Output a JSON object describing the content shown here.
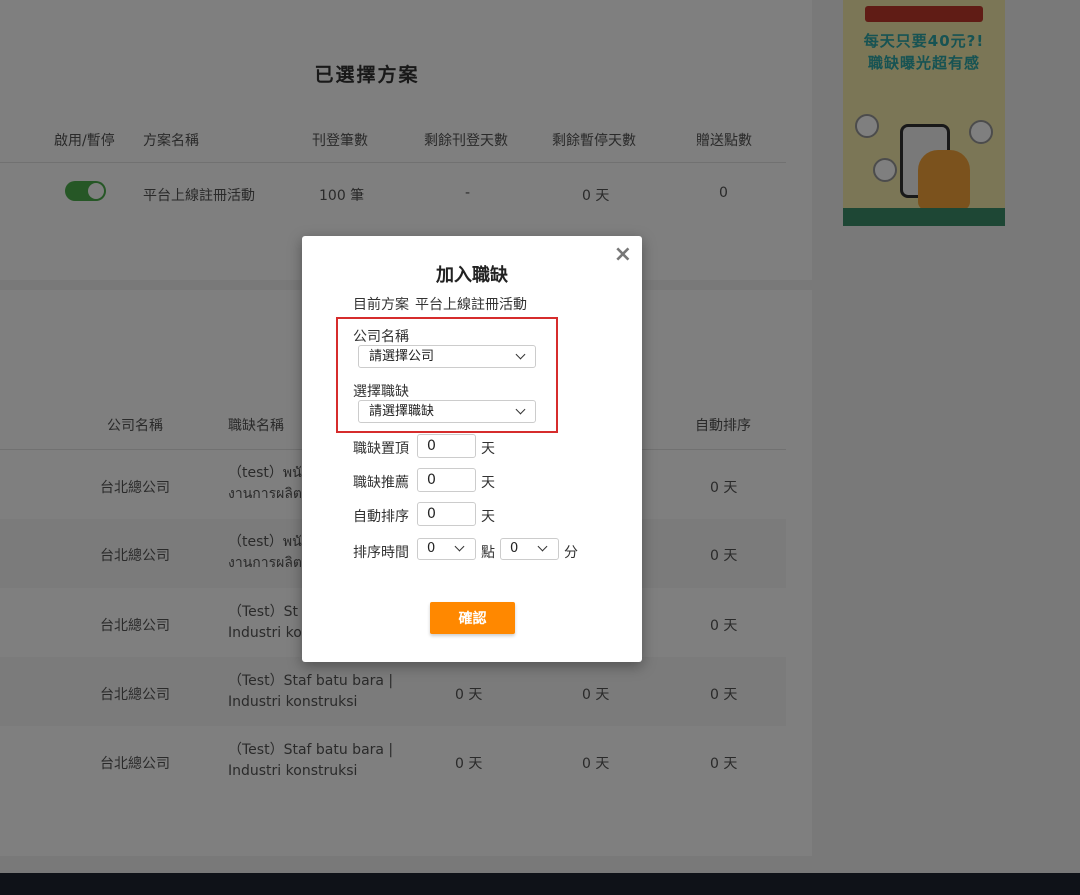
{
  "plan_section": {
    "title": "已選擇方案",
    "headers": [
      "啟用/暫停",
      "方案名稱",
      "刊登筆數",
      "剩餘刊登天數",
      "剩餘暫停天數",
      "贈送點數"
    ],
    "row": {
      "name": "平台上線註冊活動",
      "count": "100 筆",
      "remaining_days": "-",
      "paused_days": "0 天",
      "points": "0"
    }
  },
  "jobs_section": {
    "headers": [
      "公司名稱",
      "職缺名稱",
      "自動排序"
    ],
    "rows": [
      {
        "company": "台北總公司",
        "job_line1": "（test）พนั",
        "job_line2": "งานการผลิต",
        "days": "",
        "auto": "0 天"
      },
      {
        "company": "台北總公司",
        "job_line1": "（test）พนั",
        "job_line2": "งานการผลิต",
        "days": "",
        "auto": "0 天"
      },
      {
        "company": "台北總公司",
        "job_line1": "（Test）St",
        "job_line2": "Industri ko",
        "days": "",
        "auto": "0 天"
      },
      {
        "company": "台北總公司",
        "job_line1": "（Test）Staf batu bara |",
        "job_line2": "Industri konstruksi",
        "days": "0 天",
        "days2": "0 天",
        "auto": "0 天"
      },
      {
        "company": "台北總公司",
        "job_line1": "（Test）Staf batu bara |",
        "job_line2": "Industri konstruksi",
        "days": "0 天",
        "days2": "0 天",
        "auto": "0 天"
      }
    ]
  },
  "ad": {
    "line1": "每天只要40元?!",
    "line2": "職缺曝光超有感"
  },
  "modal": {
    "title": "加入職缺",
    "close": "×",
    "plan_label": "目前方案",
    "plan_value": "平台上線註冊活動",
    "company_label": "公司名稱",
    "company_select": "請選擇公司",
    "job_label": "選擇職缺",
    "job_select": "請選擇職缺",
    "top_label": "職缺置頂",
    "top_value": "0",
    "recommend_label": "職缺推薦",
    "recommend_value": "0",
    "auto_label": "自動排序",
    "auto_value": "0",
    "day_unit": "天",
    "time_label": "排序時間",
    "hour_value": "0",
    "hour_unit": "點",
    "minute_value": "0",
    "minute_unit": "分",
    "confirm": "確認"
  }
}
